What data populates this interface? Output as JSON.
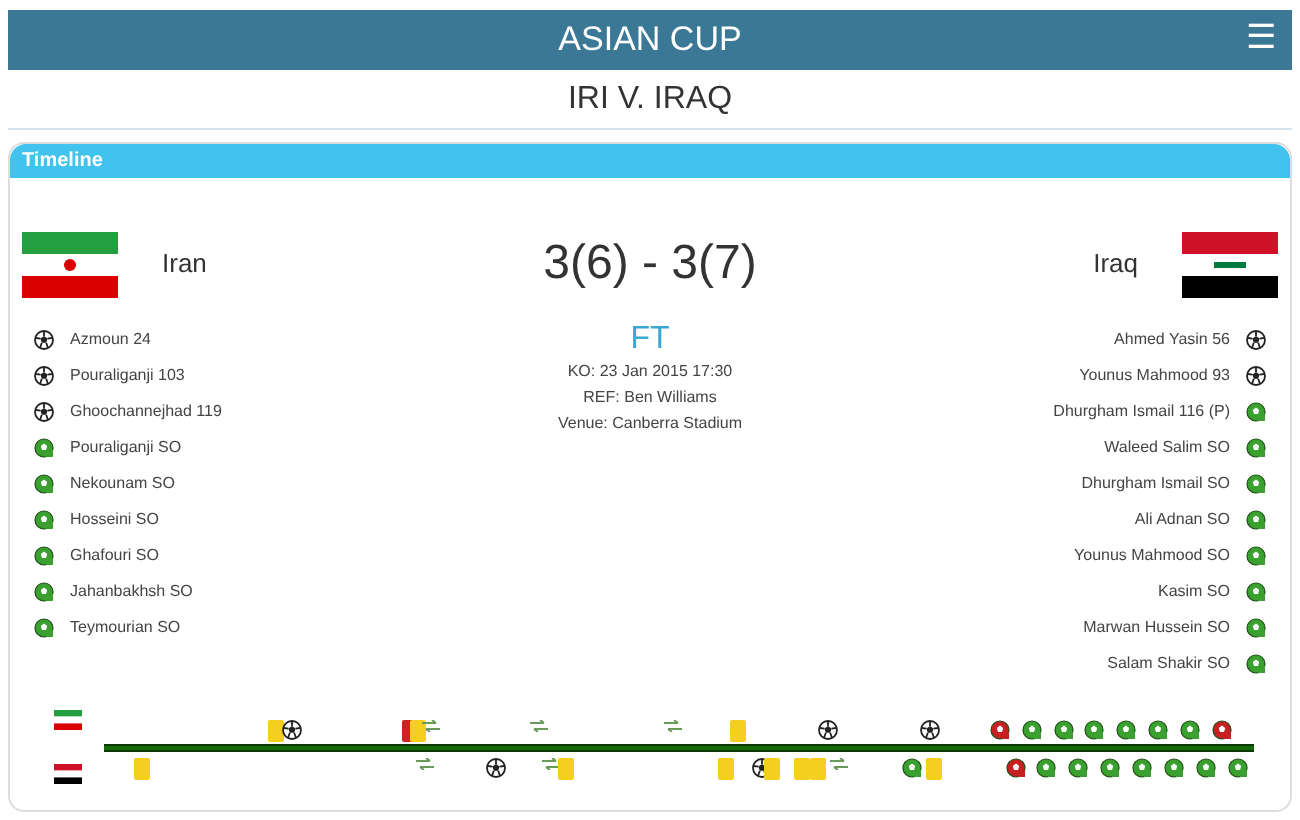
{
  "header": {
    "title": "ASIAN CUP",
    "menu_icon": "☰"
  },
  "match_title": "IRI V. IRAQ",
  "panel": {
    "title": "Timeline"
  },
  "home": {
    "name": "Iran"
  },
  "away": {
    "name": "Iraq"
  },
  "score": "3(6) - 3(7)",
  "status": "FT",
  "info": [
    "KO:  23 Jan 2015 17:30",
    "REF:  Ben Williams",
    "Venue:  Canberra Stadium"
  ],
  "home_events": [
    {
      "kind": "goal",
      "text": "Azmoun 24"
    },
    {
      "kind": "goal",
      "text": "Pouraliganji 103"
    },
    {
      "kind": "goal",
      "text": "Ghoochannejhad 119"
    },
    {
      "kind": "shootout",
      "text": "Pouraliganji SO"
    },
    {
      "kind": "shootout",
      "text": "Nekounam SO"
    },
    {
      "kind": "shootout",
      "text": "Hosseini SO"
    },
    {
      "kind": "shootout",
      "text": "Ghafouri SO"
    },
    {
      "kind": "shootout",
      "text": "Jahanbakhsh SO"
    },
    {
      "kind": "shootout",
      "text": "Teymourian SO"
    }
  ],
  "away_events": [
    {
      "kind": "goal",
      "text": "Ahmed Yasin 56"
    },
    {
      "kind": "goal",
      "text": "Younus Mahmood 93"
    },
    {
      "kind": "shootout",
      "text": "Dhurgham Ismail 116 (P)"
    },
    {
      "kind": "shootout",
      "text": "Waleed Salim SO"
    },
    {
      "kind": "shootout",
      "text": "Dhurgham Ismail SO"
    },
    {
      "kind": "shootout",
      "text": "Ali Adnan SO"
    },
    {
      "kind": "shootout",
      "text": "Younus Mahmood SO"
    },
    {
      "kind": "shootout",
      "text": "Kasim SO"
    },
    {
      "kind": "shootout",
      "text": "Marwan Hussein SO"
    },
    {
      "kind": "shootout",
      "text": "Salam Shakir SO"
    }
  ],
  "timeline": {
    "home": [
      {
        "kind": "yellow"
      },
      {
        "kind": "goal"
      },
      {
        "kind": "red"
      },
      {
        "kind": "yellow"
      },
      {
        "kind": "sub"
      },
      {
        "kind": "sub"
      },
      {
        "kind": "sub"
      },
      {
        "kind": "yellow"
      },
      {
        "kind": "goal"
      },
      {
        "kind": "goal"
      },
      {
        "kind": "so_miss"
      },
      {
        "kind": "so_score"
      },
      {
        "kind": "so_score"
      },
      {
        "kind": "so_score"
      },
      {
        "kind": "so_score"
      },
      {
        "kind": "so_score"
      },
      {
        "kind": "so_score"
      },
      {
        "kind": "so_miss"
      }
    ],
    "away": [
      {
        "kind": "yellow"
      },
      {
        "kind": "sub"
      },
      {
        "kind": "goal"
      },
      {
        "kind": "sub"
      },
      {
        "kind": "yellow"
      },
      {
        "kind": "yellow"
      },
      {
        "kind": "goal"
      },
      {
        "kind": "yellow"
      },
      {
        "kind": "yellow"
      },
      {
        "kind": "yellow"
      },
      {
        "kind": "sub"
      },
      {
        "kind": "so_score"
      },
      {
        "kind": "yellow"
      },
      {
        "kind": "so_miss"
      },
      {
        "kind": "so_score"
      },
      {
        "kind": "so_score"
      },
      {
        "kind": "so_score"
      },
      {
        "kind": "so_score"
      },
      {
        "kind": "so_score"
      },
      {
        "kind": "so_score"
      },
      {
        "kind": "so_score"
      }
    ]
  }
}
